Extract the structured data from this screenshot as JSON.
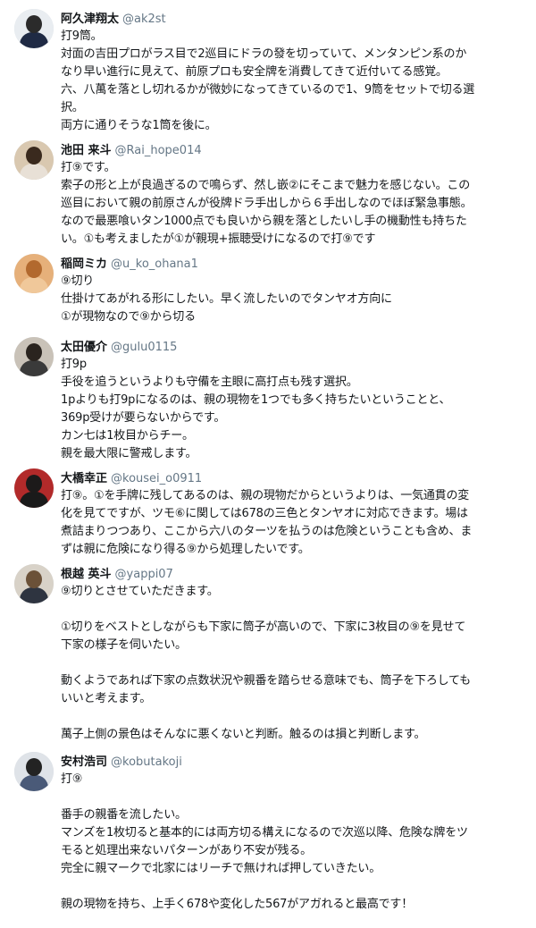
{
  "tweets": [
    {
      "name": "阿久津翔太",
      "handle": "@ak2st",
      "avatar": {
        "icon": "suited-man-avatar",
        "bg": "#e9edf1",
        "head": "#2b2b2b",
        "body": "#1f2a44"
      },
      "lines": [
        "打9筒。",
        "対面の吉田プロがラス目で2巡目にドラの發を切っていて、メンタンピン系のか",
        "なり早い進行に見えて、前原プロも安全牌を消費してきて近付いてる感覚。",
        "六、八萬を落とし切れるかが微妙になってきているので1、9筒をセットで切る選",
        "択。",
        "両方に通りそうな1筒を後に。"
      ]
    },
    {
      "name": "池田 来斗",
      "handle": "@Rai_hope014",
      "avatar": {
        "icon": "woman-avatar",
        "bg": "#d9c8b0",
        "head": "#3a2a1e",
        "body": "#e8e0d6"
      },
      "lines": [
        "打⑨です。",
        "索子の形と上が良過ぎるので鳴らず、然し嵌②にそこまで魅力を感じない。この",
        "巡目において親の前原さんが役牌ドラ手出しから６手出しなのでほぼ緊急事態。",
        "なので最悪喰いタン1000点でも良いから親を落としたいし手の機動性も持ちた",
        "い。①も考えましたが①が親現+振聴受けになるので打⑨です"
      ]
    },
    {
      "name": "稲岡ミカ",
      "handle": "@u_ko_ohana1",
      "avatar": {
        "icon": "woman-avatar",
        "bg": "#e6b07a",
        "head": "#b2692e",
        "body": "#f0c89a"
      },
      "lines": [
        "⑨切り",
        "仕掛けてあがれる形にしたい。早く流したいのでタンヤオ方向に",
        "①が現物なので⑨から切る"
      ]
    },
    {
      "name": "太田優介",
      "handle": "@gulu0115",
      "avatar": {
        "icon": "man-avatar",
        "bg": "#c9c2b8",
        "head": "#2a241f",
        "body": "#3a3a3a"
      },
      "lines": [
        "打9p",
        "手役を追うというよりも守備を主眼に高打点も残す選択。",
        "1pよりも打9pになるのは、親の現物を1つでも多く持ちたいということと、",
        "369p受けが要らないからです。",
        "カン七は1枚目からチー。",
        "親を最大限に警戒します。"
      ]
    },
    {
      "name": "大橋幸正",
      "handle": "@kousei_o0911",
      "avatar": {
        "icon": "man-avatar",
        "bg": "#b22a2a",
        "head": "#1c1a1a",
        "body": "#1a1a1a"
      },
      "lines": [
        "打⑨。①を手牌に残してあるのは、親の現物だからというよりは、一気通貫の変",
        "化を見てですが、ツモ⑥に関しては678の三色とタンヤオに対応できます。場は",
        "煮詰まりつつあり、ここから六八のターツを払うのは危険ということも含め、ま",
        "ずは親に危険になり得る⑨から処理したいです。"
      ]
    },
    {
      "name": "根越 英斗",
      "handle": "@yappi07",
      "avatar": {
        "icon": "man-avatar",
        "bg": "#d8d2c8",
        "head": "#6b5138",
        "body": "#2e3440"
      },
      "lines": [
        "⑨切りとさせていただきます。",
        "",
        "①切りをベストとしながらも下家に筒子が高いので、下家に3枚目の⑨を見せて",
        "下家の様子を伺いたい。",
        "",
        "動くようであれば下家の点数状況や親番を踏らせる意味でも、筒子を下ろしても",
        "いいと考えます。",
        "",
        "萬子上側の景色はそんなに悪くないと判断。触るのは損と判断します。"
      ]
    },
    {
      "name": "安村浩司",
      "handle": "@kobutakoji",
      "avatar": {
        "icon": "man-avatar",
        "bg": "#dfe3e8",
        "head": "#232323",
        "body": "#4a5a78"
      },
      "lines": [
        "打⑨",
        "",
        "番手の親番を流したい。",
        "マンズを1枚切ると基本的には両方切る構えになるので次巡以降、危険な牌をツ",
        "モると処理出来ないパターンがあり不安が残る。",
        "完全に親マークで北家にはリーチで無ければ押していきたい。",
        "",
        "親の現物を持ち、上手く678や変化した567がアガれると最高です！"
      ]
    }
  ]
}
